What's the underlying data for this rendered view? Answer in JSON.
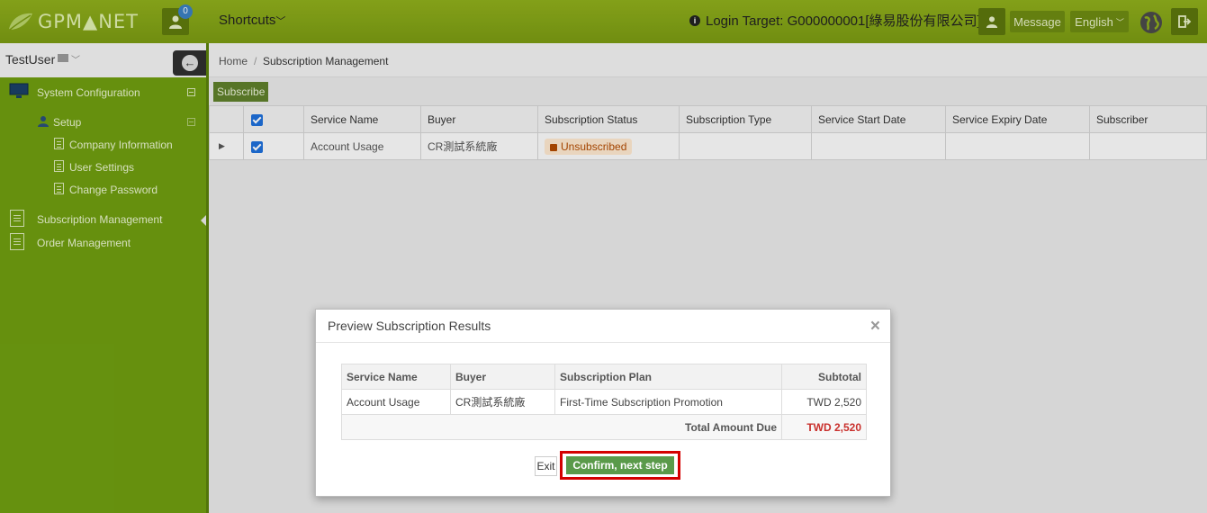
{
  "header": {
    "logo_text": "GPM▲NET",
    "notification_count": "0",
    "shortcuts_label": "Shortcuts",
    "login_target": "Login Target: G000000001[綠易股份有限公司]",
    "message_label": "Message",
    "language_label": "English"
  },
  "sidebar": {
    "username": "TestUser",
    "items": [
      {
        "label": "System Configuration"
      },
      {
        "label": "Setup"
      },
      {
        "label": "Company Information"
      },
      {
        "label": "User Settings"
      },
      {
        "label": "Change Password"
      },
      {
        "label": "Subscription Management"
      },
      {
        "label": "Order Management"
      }
    ]
  },
  "breadcrumb": {
    "home": "Home",
    "separator": "/",
    "current": "Subscription Management"
  },
  "toolbar": {
    "subscribe_label": "Subscribe"
  },
  "grid": {
    "columns": [
      "Service Name",
      "Buyer",
      "Subscription Status",
      "Subscription Type",
      "Service Start Date",
      "Service Expiry Date",
      "Subscriber"
    ],
    "rows": [
      {
        "service_name": "Account Usage",
        "buyer": "CR測試系統廠",
        "status": "Unsubscribed",
        "type": "",
        "start": "",
        "expiry": "",
        "subscriber": ""
      }
    ]
  },
  "modal": {
    "title": "Preview Subscription Results",
    "close_label": "×",
    "columns": [
      "Service Name",
      "Buyer",
      "Subscription Plan",
      "Subtotal"
    ],
    "rows": [
      {
        "service_name": "Account Usage",
        "buyer": "CR測試系統廠",
        "plan": "First-Time Subscription Promotion",
        "subtotal": "TWD 2,520"
      }
    ],
    "total_label": "Total Amount Due",
    "total_value": "TWD 2,520",
    "exit_label": "Exit",
    "confirm_label": "Confirm, next step →"
  },
  "colors": {
    "topbar": "#8fae1c",
    "sidebar": "#6f9d10",
    "confirm": "#5a9a4a",
    "highlight": "#d40000",
    "total": "#c9302c"
  }
}
